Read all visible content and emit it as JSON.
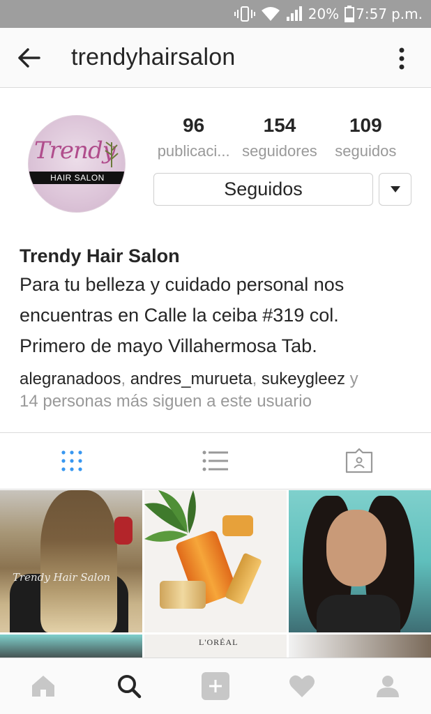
{
  "status_bar": {
    "battery_percent": "20%",
    "time": "7:57",
    "ampm": "p.m.",
    "icons": [
      "vibrate-icon",
      "wifi-icon",
      "cell-signal-icon",
      "battery-icon"
    ]
  },
  "app_bar": {
    "username": "trendyhairsalon",
    "back_icon": "arrow-left-icon",
    "more_icon": "more-vertical-icon"
  },
  "profile": {
    "avatar_logo": {
      "script": "Trendy",
      "band": "HAIR SALON"
    },
    "stats": [
      {
        "value": "96",
        "label": "publicaci..."
      },
      {
        "value": "154",
        "label": "seguidores"
      },
      {
        "value": "109",
        "label": "seguidos"
      }
    ],
    "follow_button_label": "Seguidos",
    "dropdown_icon": "caret-down-icon",
    "display_name": "Trendy Hair Salon",
    "bio_lines": [
      "Para tu belleza y cuidado personal nos",
      "encuentras en Calle la ceiba #319 col.",
      "Primero de mayo Villahermosa Tab."
    ],
    "followed_by": {
      "users": [
        "alegranadoos",
        "andres_murueta",
        "sukeygleez"
      ],
      "separator": ", ",
      "tail_connector": " y",
      "tail": "14 personas más siguen a este usuario"
    }
  },
  "tabs": [
    {
      "icon": "grid-icon",
      "active": true
    },
    {
      "icon": "list-icon",
      "active": false
    },
    {
      "icon": "tagged-photos-icon",
      "active": false
    }
  ],
  "grid": {
    "tile1_watermark": "Trendy Hair Salon",
    "tile5_brand": "L'ORÉAL"
  },
  "bottom_nav": [
    {
      "icon": "home-icon"
    },
    {
      "icon": "search-icon",
      "active": true
    },
    {
      "icon": "add-post-icon"
    },
    {
      "icon": "heart-icon"
    },
    {
      "icon": "profile-icon"
    }
  ],
  "colors": {
    "active_tab": "#3897f0",
    "inactive_icon": "#999999",
    "text_primary": "#262626",
    "text_secondary": "#999999"
  }
}
